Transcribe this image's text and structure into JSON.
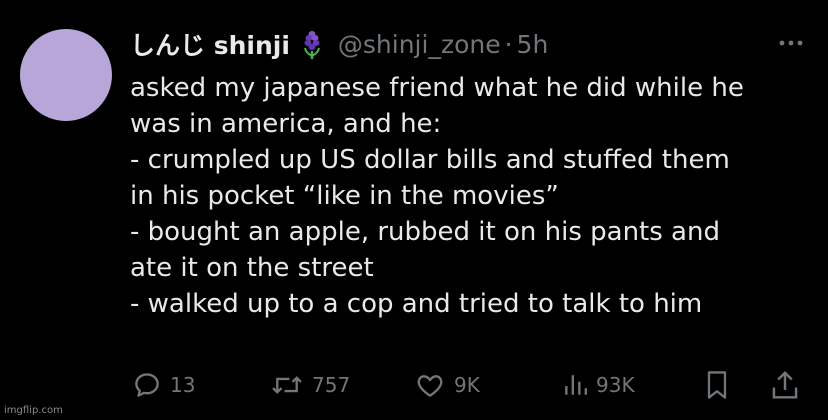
{
  "tweet": {
    "display_name": "しんじ shinji",
    "name_emoji": "hyacinth-flower-icon",
    "handle": "@shinji_zone",
    "separator": "·",
    "timestamp": "5h",
    "lines": [
      "asked my japanese friend what he did while he",
      "was in america, and he:",
      "- crumpled up US dollar bills and stuffed them",
      "in his pocket “like in the movies”",
      "- bought an apple, rubbed it on his pants and",
      "ate it on the street",
      "- walked up to a cop and tried to talk to him"
    ],
    "stats": {
      "replies": "13",
      "retweets": "757",
      "likes": "9K",
      "views": "93K"
    }
  },
  "colors": {
    "background": "#000000",
    "text": "#e7e9ea",
    "muted": "#71767b",
    "avatar": "#b8a6d9"
  },
  "watermark": "imgflip.com"
}
